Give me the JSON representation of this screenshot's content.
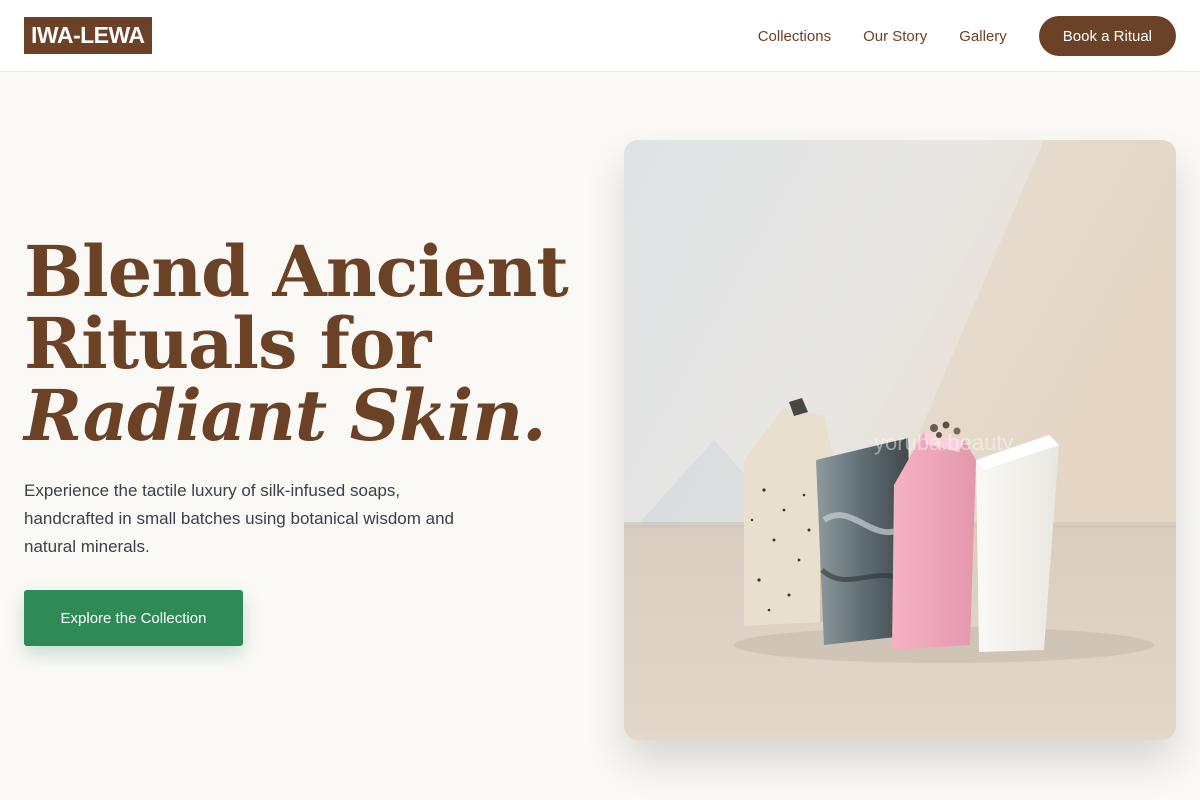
{
  "header": {
    "logo": "IWA-LEWA",
    "nav": [
      "Collections",
      "Our Story",
      "Gallery"
    ],
    "cta": "Book a Ritual"
  },
  "hero": {
    "title_line1": "Blend Ancient",
    "title_line2": "Rituals for",
    "title_line3": "Radiant Skin.",
    "description": "Experience the tactile luxury of silk-infused soaps, handcrafted in small batches using botanical wisdom and natural minerals.",
    "cta": "Explore the Collection",
    "image_watermark": "yoruba.beauty"
  },
  "colors": {
    "brand_brown": "#6b4226",
    "accent_green": "#2e8b57",
    "background": "#fbf9f6"
  }
}
